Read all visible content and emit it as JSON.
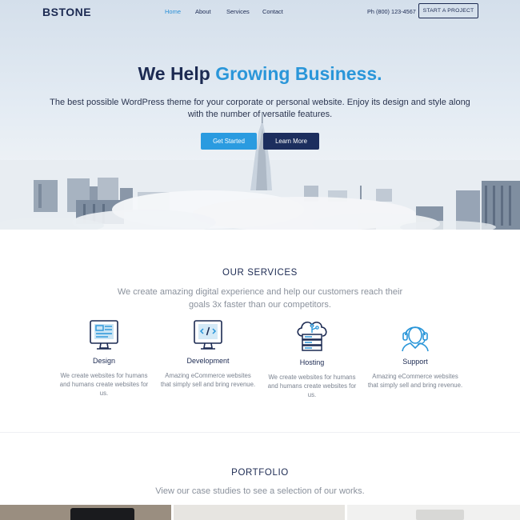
{
  "nav": {
    "logo": "BSTONE",
    "items": [
      {
        "label": "Home",
        "active": true
      },
      {
        "label": "About",
        "active": false
      },
      {
        "label": "Services",
        "active": false
      },
      {
        "label": "Contact",
        "active": false
      }
    ],
    "phone": "Ph (800) 123-4567",
    "cta": "START A PROJECT"
  },
  "hero": {
    "headline_main": "We Help ",
    "headline_accent": "Growing Business.",
    "subline": "The best possible WordPress theme for your corporate or personal website. Enjoy its design and style along with the number of versatile features.",
    "primary_button": "Get Started",
    "secondary_button": "Learn More"
  },
  "services": {
    "title": "OUR SERVICES",
    "subtitle": "We create amazing digital experience and help our customers reach their goals 3x faster than our competitors.",
    "items": [
      {
        "icon": "monitor-layout-icon",
        "name": "Design",
        "desc": "We create websites for humans and humans create websites for us."
      },
      {
        "icon": "monitor-code-icon",
        "name": "Development",
        "desc": "Amazing eCommerce websites that simply sell and bring revenue."
      },
      {
        "icon": "cloud-server-icon",
        "name": "Hosting",
        "desc": "We create websites for humans and humans create websites for us."
      },
      {
        "icon": "headset-support-icon",
        "name": "Support",
        "desc": "Amazing eCommerce websites that simply sell and bring revenue."
      }
    ]
  },
  "portfolio": {
    "title": "PORTFOLIO",
    "subtitle": "View our case studies to see a selection of our works."
  },
  "colors": {
    "accent": "#2a96d9",
    "navy": "#1c2a52",
    "button_primary": "#2a9be0",
    "button_secondary": "#1c2e5e"
  }
}
